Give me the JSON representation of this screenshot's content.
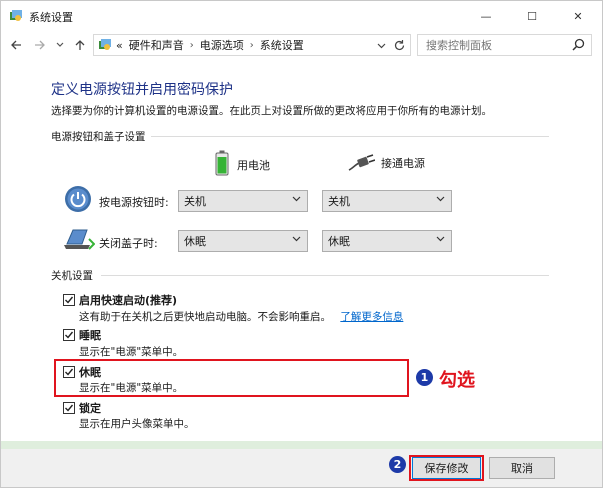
{
  "window": {
    "title": "系统设置",
    "minimize_glyph": "—",
    "maximize_glyph": "☐",
    "close_glyph": "✕"
  },
  "address_bar": {
    "prefix": "«",
    "breadcrumbs": [
      "硬件和声音",
      "电源选项",
      "系统设置"
    ],
    "search_placeholder": "搜索控制面板"
  },
  "main": {
    "title": "定义电源按钮并启用密码保护",
    "description": "选择要为你的计算机设置的电源设置。在此页上对设置所做的更改将应用于你所有的电源计划。"
  },
  "power_section": {
    "header": "电源按钮和盖子设置",
    "col_battery": "用电池",
    "col_plugged": "接通电源",
    "rows": [
      {
        "label": "按电源按钮时:",
        "battery": "关机",
        "plugged": "关机"
      },
      {
        "label": "关闭盖子时:",
        "battery": "休眠",
        "plugged": "休眠"
      }
    ]
  },
  "shutdown_section": {
    "header": "关机设置",
    "options": [
      {
        "label": "启用快速启动(推荐)",
        "desc": "这有助于在关机之后更快地启动电脑。不会影响重启。",
        "link": "了解更多信息",
        "checked": true
      },
      {
        "label": "睡眠",
        "desc": "显示在\"电源\"菜单中。",
        "checked": true
      },
      {
        "label": "休眠",
        "desc": "显示在\"电源\"菜单中。",
        "checked": true
      },
      {
        "label": "锁定",
        "desc": "显示在用户头像菜单中。",
        "checked": true
      }
    ]
  },
  "annotations": {
    "step1_number": "1",
    "step1_text": "勾选",
    "step2_number": "2",
    "color": "#e0141e"
  },
  "footer": {
    "save_label": "保存修改",
    "cancel_label": "取消"
  }
}
